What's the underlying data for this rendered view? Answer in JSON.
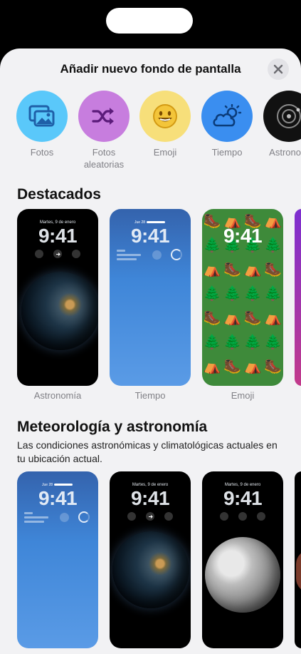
{
  "sheet": {
    "title": "Añadir nuevo fondo de pantalla"
  },
  "categories": [
    {
      "label": "Fotos",
      "icon": "photos-icon",
      "color": "#5ac8fa"
    },
    {
      "label": "Fotos aleatorias",
      "icon": "shuffle-icon",
      "color": "#c77dde"
    },
    {
      "label": "Emoji",
      "icon": "smiley-icon",
      "color": "#f7df7a"
    },
    {
      "label": "Tiempo",
      "icon": "weather-cloud-sun-icon",
      "color": "#3a8ef0"
    },
    {
      "label": "Astronom",
      "icon": "astronomy-orbit-icon",
      "color": "#111111"
    }
  ],
  "featured": {
    "title": "Destacados",
    "cards": [
      {
        "label": "Astronomía",
        "date": "Martes, 9 de enero",
        "time": "9:41"
      },
      {
        "label": "Tiempo",
        "date": "Jue 28",
        "time": "9:41"
      },
      {
        "label": "Emoji",
        "date": "",
        "time": "9:41"
      }
    ]
  },
  "weather_astronomy": {
    "title": "Meteorología y astronomía",
    "subtitle": "Las condiciones astronómicas y climatológicas actuales en tu ubicación actual.",
    "cards": [
      {
        "date": "Jue 28",
        "time": "9:41"
      },
      {
        "date": "Martes, 9 de enero",
        "time": "9:41"
      },
      {
        "date": "Martes, 9 de enero",
        "time": "9:41"
      }
    ]
  }
}
